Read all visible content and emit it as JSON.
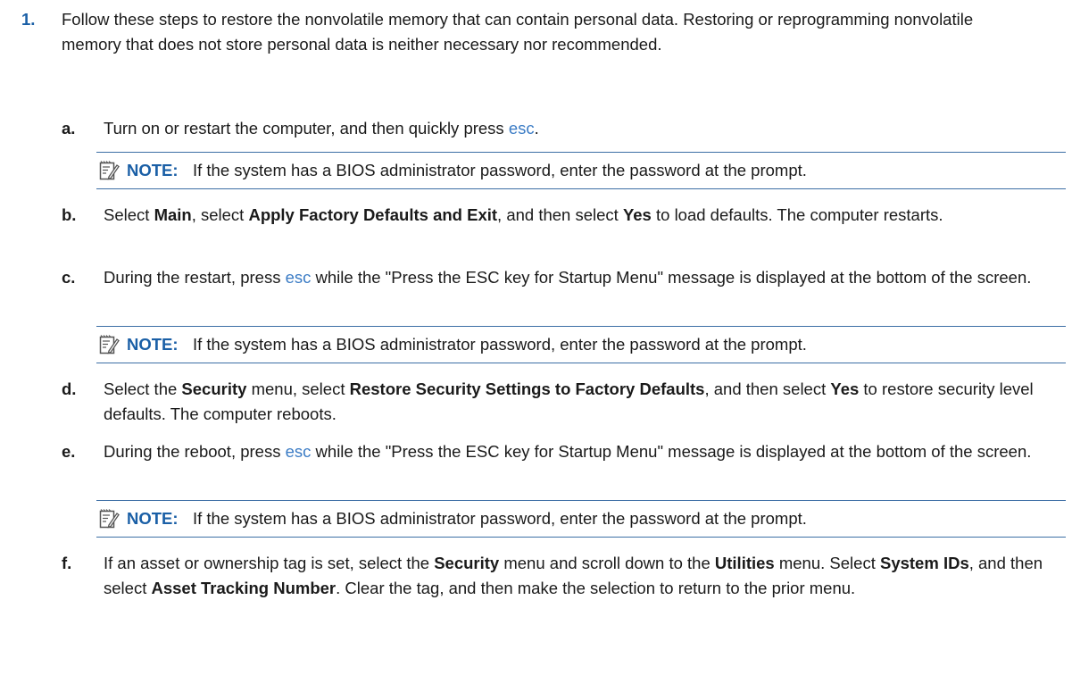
{
  "step": {
    "number": "1.",
    "text": "Follow these steps to restore the nonvolatile memory that can contain personal data. Restoring or reprogramming nonvolatile memory that does not store personal data is neither necessary nor recommended."
  },
  "note": {
    "label": "NOTE:",
    "text": "If the system has a BIOS administrator password, enter the password at the prompt."
  },
  "substeps": {
    "a": {
      "letter": "a.",
      "t1": "Turn on or restart the computer, and then quickly press ",
      "key": "esc",
      "t2": "."
    },
    "b": {
      "letter": "b.",
      "t1": "Select ",
      "b1": "Main",
      "t2": ", select ",
      "b2": "Apply Factory Defaults and Exit",
      "t3": ", and then select ",
      "b3": "Yes",
      "t4": " to load defaults. The computer restarts."
    },
    "c": {
      "letter": "c.",
      "t1": "During the restart, press ",
      "key": "esc",
      "t2": " while the \"Press the ESC key for Startup Menu\" message is displayed at the bottom of the screen."
    },
    "d": {
      "letter": "d.",
      "t1": "Select the ",
      "b1": "Security",
      "t2": " menu, select ",
      "b2": "Restore Security Settings to Factory Defaults",
      "t3": ", and then select ",
      "b3": "Yes",
      "t4": " to restore security level defaults. The computer reboots."
    },
    "e": {
      "letter": "e.",
      "t1": "During the reboot, press ",
      "key": "esc",
      "t2": " while the \"Press the ESC key for Startup Menu\" message is displayed at the bottom of the screen."
    },
    "f": {
      "letter": "f.",
      "t1": "If an asset or ownership tag is set, select the ",
      "b1": "Security",
      "t2": " menu and scroll down to the ",
      "b2": "Utilities",
      "t3": " menu. Select ",
      "b3": "System IDs",
      "t4": ", and then select ",
      "b4": "Asset Tracking Number",
      "t5": ". Clear the tag, and then make the selection to return to the prior menu."
    }
  },
  "colors": {
    "accent": "#1a5fa6",
    "key_link": "#3b7cc5",
    "note_rule": "#3d6fa5",
    "text": "#1a1a1a"
  },
  "icons": {
    "note": "note-pencil-icon"
  }
}
